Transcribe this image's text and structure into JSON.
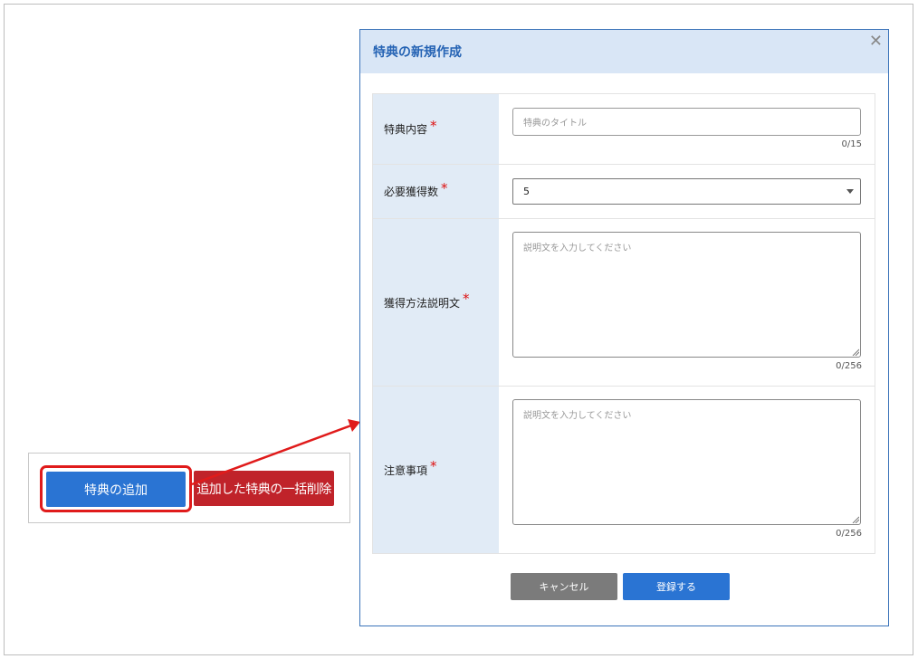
{
  "page": {
    "add_benefit_button": "特典の追加",
    "bulk_delete_button": "追加した特典の一括削除"
  },
  "modal": {
    "title": "特典の新規作成",
    "close_icon": "close-icon",
    "fields": {
      "content": {
        "label": "特典内容",
        "placeholder": "特典のタイトル",
        "counter": "0/15"
      },
      "required_count": {
        "label": "必要獲得数",
        "value": "5"
      },
      "acquisition_description": {
        "label": "獲得方法説明文",
        "placeholder": "説明文を入力してください",
        "counter": "0/256"
      },
      "notes": {
        "label": "注意事項",
        "placeholder": "説明文を入力してください",
        "counter": "0/256"
      }
    },
    "required_mark": "*",
    "cancel_button": "キャンセル",
    "register_button": "登録する"
  },
  "colors": {
    "accent_blue": "#2a74d3",
    "delete_red": "#c0232a",
    "highlight_red": "#e01b1b",
    "header_bg": "#d9e6f6",
    "label_bg": "#e1ebf6"
  }
}
